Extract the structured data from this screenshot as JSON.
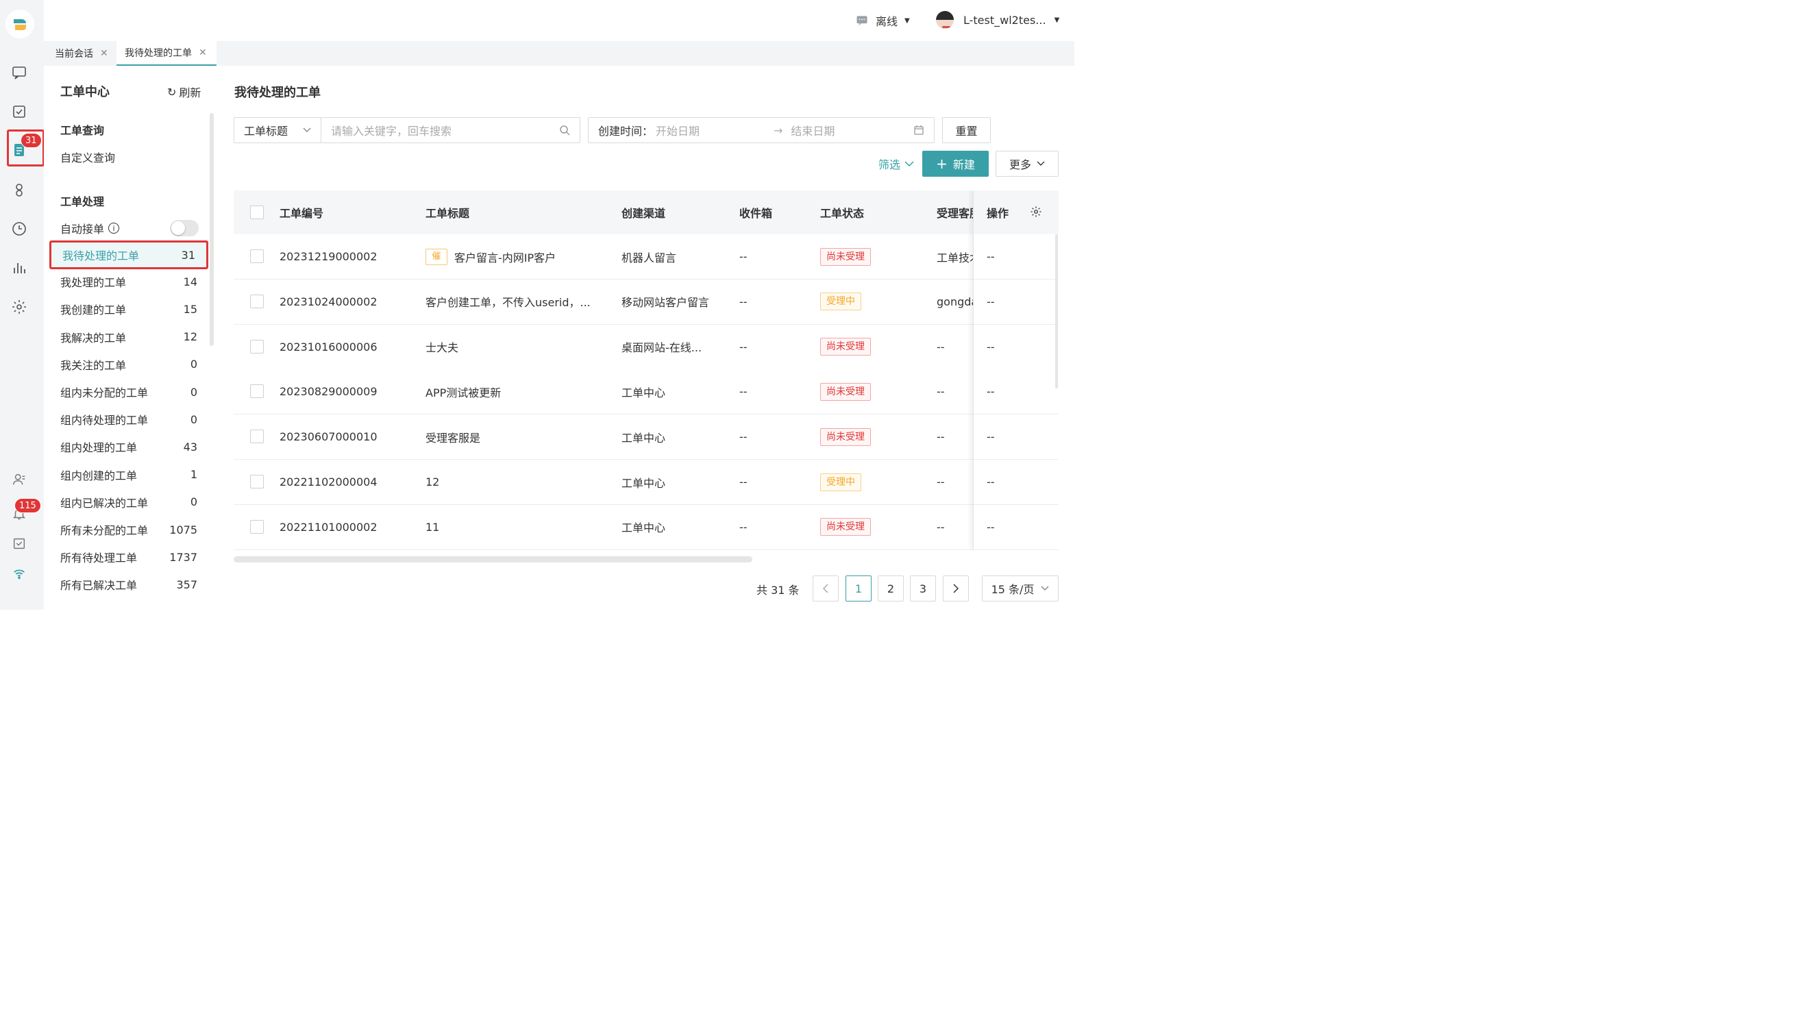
{
  "rail": {
    "badge_tickets": "31",
    "badge_notify": "115"
  },
  "topbar": {
    "status": "离线",
    "user": "L-test_wl2tes..."
  },
  "tabs": [
    {
      "label": "当前会话"
    },
    {
      "label": "我待处理的工单"
    }
  ],
  "side": {
    "title": "工单中心",
    "refresh": "刷新",
    "query_heading": "工单查询",
    "custom_query": "自定义查询",
    "process_heading": "工单处理",
    "auto_accept": "自动接单",
    "items": [
      {
        "label": "我待处理的工单",
        "count": "31"
      },
      {
        "label": "我处理的工单",
        "count": "14"
      },
      {
        "label": "我创建的工单",
        "count": "15"
      },
      {
        "label": "我解决的工单",
        "count": "12"
      },
      {
        "label": "我关注的工单",
        "count": "0"
      },
      {
        "label": "组内未分配的工单",
        "count": "0"
      },
      {
        "label": "组内待处理的工单",
        "count": "0"
      },
      {
        "label": "组内处理的工单",
        "count": "43"
      },
      {
        "label": "组内创建的工单",
        "count": "1"
      },
      {
        "label": "组内已解决的工单",
        "count": "0"
      },
      {
        "label": "所有未分配的工单",
        "count": "1075"
      },
      {
        "label": "所有待处理工单",
        "count": "1737"
      },
      {
        "label": "所有已解决工单",
        "count": "357"
      }
    ]
  },
  "main": {
    "title": "我待处理的工单",
    "search_field": "工单标题",
    "search_placeholder": "请输入关键字，回车搜索",
    "date_label": "创建时间：",
    "date_start": "开始日期",
    "date_end": "结束日期",
    "reset": "重置",
    "filter": "筛选",
    "new": "新建",
    "more": "更多"
  },
  "table": {
    "columns": [
      "工单编号",
      "工单标题",
      "创建渠道",
      "收件箱",
      "工单状态",
      "受理客服",
      "操作"
    ],
    "rows": [
      {
        "id": "20231219000002",
        "urge": "催",
        "title": "客户留言-内网IP客户",
        "channel": "机器人留言",
        "inbox": "--",
        "status": "尚未受理",
        "status_type": "red",
        "agent": "工单技术",
        "op": "--"
      },
      {
        "id": "20231024000002",
        "urge": "",
        "title": "客户创建工单，不传入userid，...",
        "channel": "移动网站客户留言",
        "inbox": "--",
        "status": "受理中",
        "status_type": "orange",
        "agent": "gongdan",
        "op": "--"
      },
      {
        "id": "20231016000006",
        "urge": "",
        "title": "士大夫",
        "channel": "桌面网站-在线...",
        "inbox": "--",
        "status": "尚未受理",
        "status_type": "red",
        "agent": "--",
        "op": "--"
      },
      {
        "id": "20230829000009",
        "urge": "",
        "title": "APP测试被更新",
        "channel": "工单中心",
        "inbox": "--",
        "status": "尚未受理",
        "status_type": "red",
        "agent": "--",
        "op": "--"
      },
      {
        "id": "20230607000010",
        "urge": "",
        "title": "受理客服是",
        "channel": "工单中心",
        "inbox": "--",
        "status": "尚未受理",
        "status_type": "red",
        "agent": "--",
        "op": "--"
      },
      {
        "id": "20221102000004",
        "urge": "",
        "title": "12",
        "channel": "工单中心",
        "inbox": "--",
        "status": "受理中",
        "status_type": "orange",
        "agent": "--",
        "op": "--"
      },
      {
        "id": "20221101000002",
        "urge": "",
        "title": "11",
        "channel": "工单中心",
        "inbox": "--",
        "status": "尚未受理",
        "status_type": "red",
        "agent": "--",
        "op": "--"
      }
    ]
  },
  "pagination": {
    "total": "共 31 条",
    "pages": [
      "1",
      "2",
      "3"
    ],
    "current": "1",
    "page_size": "15 条/页"
  }
}
